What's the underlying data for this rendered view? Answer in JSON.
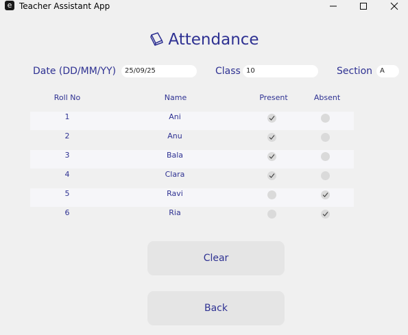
{
  "window": {
    "title": "Teacher Assistant App",
    "icon_letter": "e",
    "controls": [
      "minimize-icon",
      "maximize-icon",
      "close-icon"
    ]
  },
  "heading": {
    "text": "Attendance",
    "icon": "book-icon"
  },
  "form": {
    "date_label": "Date (DD/MM/YY)",
    "date_value": "25/09/25",
    "class_label": "Class",
    "class_value": "10",
    "section_label": "Section",
    "section_value": "A"
  },
  "table": {
    "headers": {
      "roll": "Roll No",
      "name": "Name",
      "present": "Present",
      "absent": "Absent"
    },
    "rows": [
      {
        "roll": "1",
        "name": "Ani",
        "present": true,
        "absent": false
      },
      {
        "roll": "2",
        "name": "Anu",
        "present": true,
        "absent": false
      },
      {
        "roll": "3",
        "name": "Bala",
        "present": true,
        "absent": false
      },
      {
        "roll": "4",
        "name": "Clara",
        "present": true,
        "absent": false
      },
      {
        "roll": "5",
        "name": "Ravi",
        "present": false,
        "absent": true
      },
      {
        "roll": "6",
        "name": "Ria",
        "present": false,
        "absent": true
      }
    ]
  },
  "buttons": {
    "clear": "Clear",
    "back": "Back"
  },
  "colors": {
    "accent": "#2e3192",
    "background": "#f0f0f0",
    "button": "#e5e5e5",
    "row_shade": "#f6f6f9"
  }
}
